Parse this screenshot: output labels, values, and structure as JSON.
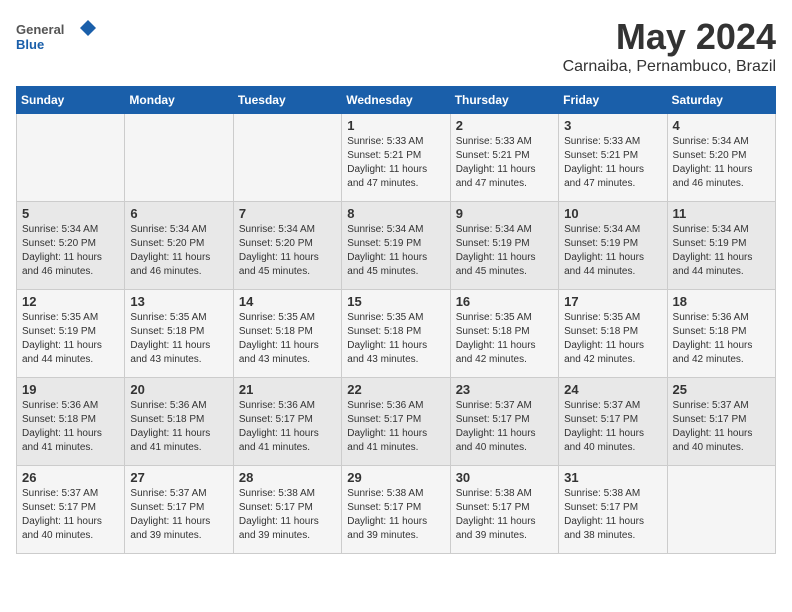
{
  "header": {
    "logo_general": "General",
    "logo_blue": "Blue",
    "title": "May 2024",
    "subtitle": "Carnaiba, Pernambuco, Brazil"
  },
  "days_of_week": [
    "Sunday",
    "Monday",
    "Tuesday",
    "Wednesday",
    "Thursday",
    "Friday",
    "Saturday"
  ],
  "weeks": [
    [
      {
        "day": "",
        "info": ""
      },
      {
        "day": "",
        "info": ""
      },
      {
        "day": "",
        "info": ""
      },
      {
        "day": "1",
        "info": "Sunrise: 5:33 AM\nSunset: 5:21 PM\nDaylight: 11 hours\nand 47 minutes."
      },
      {
        "day": "2",
        "info": "Sunrise: 5:33 AM\nSunset: 5:21 PM\nDaylight: 11 hours\nand 47 minutes."
      },
      {
        "day": "3",
        "info": "Sunrise: 5:33 AM\nSunset: 5:21 PM\nDaylight: 11 hours\nand 47 minutes."
      },
      {
        "day": "4",
        "info": "Sunrise: 5:34 AM\nSunset: 5:20 PM\nDaylight: 11 hours\nand 46 minutes."
      }
    ],
    [
      {
        "day": "5",
        "info": "Sunrise: 5:34 AM\nSunset: 5:20 PM\nDaylight: 11 hours\nand 46 minutes."
      },
      {
        "day": "6",
        "info": "Sunrise: 5:34 AM\nSunset: 5:20 PM\nDaylight: 11 hours\nand 46 minutes."
      },
      {
        "day": "7",
        "info": "Sunrise: 5:34 AM\nSunset: 5:20 PM\nDaylight: 11 hours\nand 45 minutes."
      },
      {
        "day": "8",
        "info": "Sunrise: 5:34 AM\nSunset: 5:19 PM\nDaylight: 11 hours\nand 45 minutes."
      },
      {
        "day": "9",
        "info": "Sunrise: 5:34 AM\nSunset: 5:19 PM\nDaylight: 11 hours\nand 45 minutes."
      },
      {
        "day": "10",
        "info": "Sunrise: 5:34 AM\nSunset: 5:19 PM\nDaylight: 11 hours\nand 44 minutes."
      },
      {
        "day": "11",
        "info": "Sunrise: 5:34 AM\nSunset: 5:19 PM\nDaylight: 11 hours\nand 44 minutes."
      }
    ],
    [
      {
        "day": "12",
        "info": "Sunrise: 5:35 AM\nSunset: 5:19 PM\nDaylight: 11 hours\nand 44 minutes."
      },
      {
        "day": "13",
        "info": "Sunrise: 5:35 AM\nSunset: 5:18 PM\nDaylight: 11 hours\nand 43 minutes."
      },
      {
        "day": "14",
        "info": "Sunrise: 5:35 AM\nSunset: 5:18 PM\nDaylight: 11 hours\nand 43 minutes."
      },
      {
        "day": "15",
        "info": "Sunrise: 5:35 AM\nSunset: 5:18 PM\nDaylight: 11 hours\nand 43 minutes."
      },
      {
        "day": "16",
        "info": "Sunrise: 5:35 AM\nSunset: 5:18 PM\nDaylight: 11 hours\nand 42 minutes."
      },
      {
        "day": "17",
        "info": "Sunrise: 5:35 AM\nSunset: 5:18 PM\nDaylight: 11 hours\nand 42 minutes."
      },
      {
        "day": "18",
        "info": "Sunrise: 5:36 AM\nSunset: 5:18 PM\nDaylight: 11 hours\nand 42 minutes."
      }
    ],
    [
      {
        "day": "19",
        "info": "Sunrise: 5:36 AM\nSunset: 5:18 PM\nDaylight: 11 hours\nand 41 minutes."
      },
      {
        "day": "20",
        "info": "Sunrise: 5:36 AM\nSunset: 5:18 PM\nDaylight: 11 hours\nand 41 minutes."
      },
      {
        "day": "21",
        "info": "Sunrise: 5:36 AM\nSunset: 5:17 PM\nDaylight: 11 hours\nand 41 minutes."
      },
      {
        "day": "22",
        "info": "Sunrise: 5:36 AM\nSunset: 5:17 PM\nDaylight: 11 hours\nand 41 minutes."
      },
      {
        "day": "23",
        "info": "Sunrise: 5:37 AM\nSunset: 5:17 PM\nDaylight: 11 hours\nand 40 minutes."
      },
      {
        "day": "24",
        "info": "Sunrise: 5:37 AM\nSunset: 5:17 PM\nDaylight: 11 hours\nand 40 minutes."
      },
      {
        "day": "25",
        "info": "Sunrise: 5:37 AM\nSunset: 5:17 PM\nDaylight: 11 hours\nand 40 minutes."
      }
    ],
    [
      {
        "day": "26",
        "info": "Sunrise: 5:37 AM\nSunset: 5:17 PM\nDaylight: 11 hours\nand 40 minutes."
      },
      {
        "day": "27",
        "info": "Sunrise: 5:37 AM\nSunset: 5:17 PM\nDaylight: 11 hours\nand 39 minutes."
      },
      {
        "day": "28",
        "info": "Sunrise: 5:38 AM\nSunset: 5:17 PM\nDaylight: 11 hours\nand 39 minutes."
      },
      {
        "day": "29",
        "info": "Sunrise: 5:38 AM\nSunset: 5:17 PM\nDaylight: 11 hours\nand 39 minutes."
      },
      {
        "day": "30",
        "info": "Sunrise: 5:38 AM\nSunset: 5:17 PM\nDaylight: 11 hours\nand 39 minutes."
      },
      {
        "day": "31",
        "info": "Sunrise: 5:38 AM\nSunset: 5:17 PM\nDaylight: 11 hours\nand 38 minutes."
      },
      {
        "day": "",
        "info": ""
      }
    ]
  ]
}
